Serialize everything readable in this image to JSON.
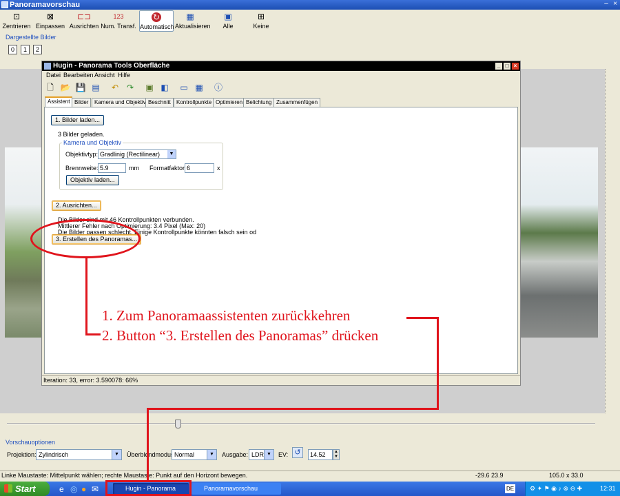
{
  "outer": {
    "title": "Panoramavorschau",
    "toolbar": [
      {
        "label": "Zentrieren",
        "icon": "center-icon"
      },
      {
        "label": "Einpassen",
        "icon": "fit-icon"
      },
      {
        "label": "Ausrichten",
        "icon": "straighten-icon"
      },
      {
        "label": "Num. Transf.",
        "icon": "numeric-transform-icon",
        "glyph": "123"
      },
      {
        "label": "Automatisch",
        "icon": "auto-icon",
        "active": true
      },
      {
        "label": "Aktualisieren",
        "icon": "update-icon"
      },
      {
        "label": "Alle",
        "icon": "all-images-icon"
      },
      {
        "label": "Keine",
        "icon": "no-images-icon"
      }
    ],
    "displayed_images_label": "Dargestellte Bilder",
    "image_buttons": [
      "0",
      "1",
      "2"
    ],
    "preview_options_label": "Vorschauoptionen",
    "projection_label": "Projektion:",
    "projection_value": "Zylindrisch",
    "blend_label": "Überblendmodus:",
    "blend_value": "Normal",
    "output_label": "Ausgabe:",
    "output_value": "LDR",
    "ev_label": "EV:",
    "ev_value": "14.52",
    "status_left": "Linke Maustaste: Mittelpunkt wählen; rechte Maustaste: Punkt auf den Horizont bewegen.",
    "status_coords": "-29.6 23.9",
    "status_fov": "105.0 x 33.0"
  },
  "taskbar": {
    "start_label": "Start",
    "tasks": [
      "Hugin - Panorama To...",
      "Panoramavorschau"
    ],
    "language": "DE",
    "clock": "12:31"
  },
  "hugin": {
    "title": "Hugin - Panorama Tools Oberfläche",
    "menu": [
      "Datei",
      "Bearbeiten",
      "Ansicht",
      "Hilfe"
    ],
    "tabs": [
      "Assistent",
      "Bilder",
      "Kamera und Objektiv",
      "Beschnitt",
      "Kontrollpunkte",
      "Optimieren",
      "Belichtung",
      "Zusammenfügen"
    ],
    "load_button": "1. Bilder laden...",
    "loaded_text": "3 Bilder geladen.",
    "camera_group_label": "Kamera und Objektiv",
    "lens_type_label": "Objektivtyp:",
    "lens_type_value": "Gradlinig (Rectilinear)",
    "focal_label": "Brennweite:",
    "focal_value": "5.9",
    "focal_unit": "mm",
    "crop_label": "Formatfaktor:",
    "crop_value": "6",
    "crop_unit": "x",
    "load_lens_button": "Objektiv laden...",
    "align_button": "2. Ausrichten...",
    "result_line1": "Die Bilder sind mit 46 Kontrollpunkten verbunden.",
    "result_line2": "Mittlerer Fehler nach Optimierung: 3.4 Pixel (Max: 20)",
    "result_line3": "Die Bilder passen schlecht. Einige Kontrollpunkte könnten falsch sein od",
    "create_button": "3. Erstellen des Panoramas...",
    "status": "Iteration: 33, error: 3.590078: 66%"
  },
  "annotation": {
    "line1": "1. Zum Panoramaassistenten zurückkehren",
    "line2": "2. Button “3. Erstellen des Panoramas” drücken",
    "color": "#e0141c"
  }
}
